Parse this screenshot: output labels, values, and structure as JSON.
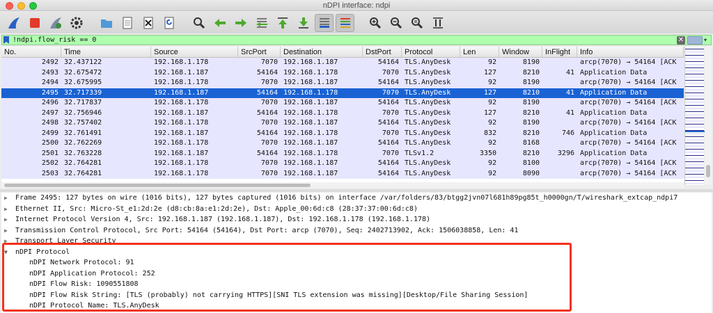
{
  "window": {
    "title": "nDPI interface: ndpi"
  },
  "toolbar": {
    "buttons": [
      "shark-fin-start-icon",
      "stop-square-icon",
      "restart-icon",
      "options-gear-icon",
      "open-folder-icon",
      "save-file-icon",
      "close-file-icon",
      "reload-icon",
      "find-magnifier-icon",
      "back-arrow-icon",
      "forward-arrow-icon",
      "go-to-packet-icon",
      "first-packet-icon",
      "last-packet-icon",
      "autoscroll-icon",
      "colorize-icon",
      "zoom-in-icon",
      "zoom-out-icon",
      "zoom-normal-icon",
      "resize-columns-icon"
    ]
  },
  "filter": {
    "text": "!ndpi.flow_risk == 0"
  },
  "columns": [
    "No.",
    "Time",
    "Source",
    "SrcPort",
    "Destination",
    "DstPort",
    "Protocol",
    "Len",
    "Window",
    "InFlight",
    "Info"
  ],
  "packets": [
    {
      "no": "2492",
      "time": "32.437122",
      "src": "192.168.1.178",
      "sport": "7070",
      "dst": "192.168.1.187",
      "dport": "54164",
      "proto": "TLS.AnyDesk",
      "len": "92",
      "win": "8190",
      "inflight": "",
      "info": "arcp(7070) → 54164 [ACK"
    },
    {
      "no": "2493",
      "time": "32.675472",
      "src": "192.168.1.187",
      "sport": "54164",
      "dst": "192.168.1.178",
      "dport": "7070",
      "proto": "TLS.AnyDesk",
      "len": "127",
      "win": "8210",
      "inflight": "41",
      "info": "Application Data"
    },
    {
      "no": "2494",
      "time": "32.675995",
      "src": "192.168.1.178",
      "sport": "7070",
      "dst": "192.168.1.187",
      "dport": "54164",
      "proto": "TLS.AnyDesk",
      "len": "92",
      "win": "8190",
      "inflight": "",
      "info": "arcp(7070) → 54164 [ACK"
    },
    {
      "no": "2495",
      "time": "32.717339",
      "src": "192.168.1.187",
      "sport": "54164",
      "dst": "192.168.1.178",
      "dport": "7070",
      "proto": "TLS.AnyDesk",
      "len": "127",
      "win": "8210",
      "inflight": "41",
      "info": "Application Data",
      "selected": true
    },
    {
      "no": "2496",
      "time": "32.717837",
      "src": "192.168.1.178",
      "sport": "7070",
      "dst": "192.168.1.187",
      "dport": "54164",
      "proto": "TLS.AnyDesk",
      "len": "92",
      "win": "8190",
      "inflight": "",
      "info": "arcp(7070) → 54164 [ACK"
    },
    {
      "no": "2497",
      "time": "32.756946",
      "src": "192.168.1.187",
      "sport": "54164",
      "dst": "192.168.1.178",
      "dport": "7070",
      "proto": "TLS.AnyDesk",
      "len": "127",
      "win": "8210",
      "inflight": "41",
      "info": "Application Data"
    },
    {
      "no": "2498",
      "time": "32.757402",
      "src": "192.168.1.178",
      "sport": "7070",
      "dst": "192.168.1.187",
      "dport": "54164",
      "proto": "TLS.AnyDesk",
      "len": "92",
      "win": "8190",
      "inflight": "",
      "info": "arcp(7070) → 54164 [ACK"
    },
    {
      "no": "2499",
      "time": "32.761491",
      "src": "192.168.1.187",
      "sport": "54164",
      "dst": "192.168.1.178",
      "dport": "7070",
      "proto": "TLS.AnyDesk",
      "len": "832",
      "win": "8210",
      "inflight": "746",
      "info": "Application Data"
    },
    {
      "no": "2500",
      "time": "32.762269",
      "src": "192.168.1.178",
      "sport": "7070",
      "dst": "192.168.1.187",
      "dport": "54164",
      "proto": "TLS.AnyDesk",
      "len": "92",
      "win": "8168",
      "inflight": "",
      "info": "arcp(7070) → 54164 [ACK"
    },
    {
      "no": "2501",
      "time": "32.763228",
      "src": "192.168.1.187",
      "sport": "54164",
      "dst": "192.168.1.178",
      "dport": "7070",
      "proto": "TLSv1.2",
      "len": "3350",
      "win": "8210",
      "inflight": "3296",
      "info": "Application Data"
    },
    {
      "no": "2502",
      "time": "32.764281",
      "src": "192.168.1.178",
      "sport": "7070",
      "dst": "192.168.1.187",
      "dport": "54164",
      "proto": "TLS.AnyDesk",
      "len": "92",
      "win": "8100",
      "inflight": "",
      "info": "arcp(7070) → 54164 [ACK"
    },
    {
      "no": "2503",
      "time": "32.764281",
      "src": "192.168.1.178",
      "sport": "7070",
      "dst": "192.168.1.187",
      "dport": "54164",
      "proto": "TLS.AnyDesk",
      "len": "92",
      "win": "8090",
      "inflight": "",
      "info": "arcp(7070) → 54164 [ACK"
    }
  ],
  "details": {
    "frame": "Frame 2495: 127 bytes on wire (1016 bits), 127 bytes captured (1016 bits) on interface /var/folders/83/btgg2jvn07l681h89pg85t_h0000gn/T/wireshark_extcap_ndpi7",
    "ethernet": "Ethernet II, Src: Micro-St_e1:2d:2e (d8:cb:8a:e1:2d:2e), Dst: Apple_00:6d:c8 (28:37:37:00:6d:c8)",
    "ip": "Internet Protocol Version 4, Src: 192.168.1.187 (192.168.1.187), Dst: 192.168.1.178 (192.168.1.178)",
    "tcp": "Transmission Control Protocol, Src Port: 54164 (54164), Dst Port: arcp (7070), Seq: 2402713902, Ack: 1506038858, Len: 41",
    "tls": "Transport Layer Security",
    "ndpi": "nDPI Protocol",
    "ndpi_fields": [
      "nDPI Network Protocol: 91",
      "nDPI Application Protocol: 252",
      "nDPI Flow Risk: 1090551808",
      "nDPI Flow Risk String: [TLS (probably) not carrying HTTPS][SNI TLS extension was missing][Desktop/File Sharing Session]",
      "nDPI Protocol Name: TLS.AnyDesk"
    ]
  },
  "colors": {
    "selection": "#1a62d3",
    "row_bg": "#e7e6ff",
    "filter_bg": "#afffaf",
    "highlight": "#f4311c"
  }
}
